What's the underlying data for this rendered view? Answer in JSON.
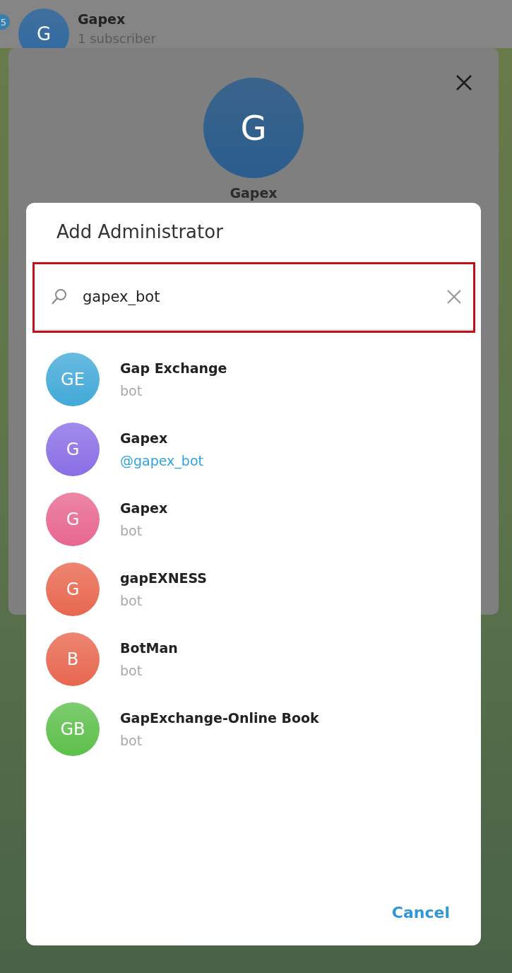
{
  "chat_header": {
    "badge": "5",
    "avatar_initial": "G",
    "title": "Gapex",
    "subtitle": "1 subscriber"
  },
  "profile_card": {
    "avatar_initial": "G",
    "name": "Gapex"
  },
  "dialog": {
    "title": "Add Administrator",
    "search": {
      "value": "gapex_bot",
      "highlighted": true
    },
    "results": [
      {
        "initials": "GE",
        "name": "Gap Exchange",
        "subtitle": "bot",
        "kind": "status",
        "color": "#42a9d8"
      },
      {
        "initials": "G",
        "name": "Gapex",
        "subtitle": "@gapex_bot",
        "kind": "username",
        "color": "#8a6ee6"
      },
      {
        "initials": "G",
        "name": "Gapex",
        "subtitle": "bot",
        "kind": "status",
        "color": "#e8678f"
      },
      {
        "initials": "G",
        "name": "gapEXNESS",
        "subtitle": "bot",
        "kind": "status",
        "color": "#e8674f"
      },
      {
        "initials": "B",
        "name": "BotMan",
        "subtitle": "bot",
        "kind": "status",
        "color": "#e8674f"
      },
      {
        "initials": "GB",
        "name": "GapExchange-Online Book",
        "subtitle": "bot",
        "kind": "status",
        "color": "#5cc04a"
      }
    ],
    "cancel": "Cancel"
  }
}
